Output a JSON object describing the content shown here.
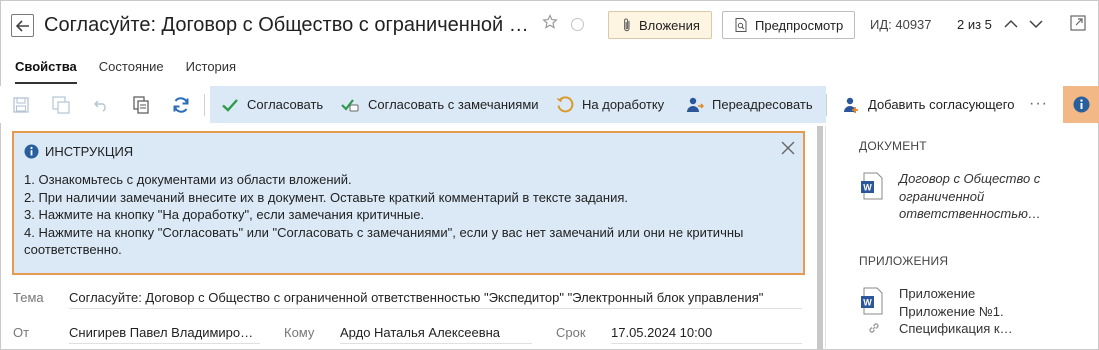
{
  "header": {
    "title": "Согласуйте: Договор с Общество с ограниченной ответственностью \"Экспедитор\"",
    "attachments_label": "Вложения",
    "preview_label": "Предпросмотр",
    "id_text": "ИД: 40937",
    "pager_text": "2 из 5"
  },
  "tabs": [
    {
      "label": "Свойства",
      "active": true
    },
    {
      "label": "Состояние",
      "active": false
    },
    {
      "label": "История",
      "active": false
    }
  ],
  "toolbar": {
    "approve": "Согласовать",
    "approve_remarks": "Согласовать с замечаниями",
    "rework": "На доработку",
    "readdress": "Переадресовать",
    "add_approver": "Добавить согласующего",
    "more": "···"
  },
  "instruction": {
    "title": "ИНСТРУКЦИЯ",
    "lines": [
      "1. Ознакомьтесь с документами из области вложений.",
      "2. При наличии замечаний внесите их в документ. Оставьте краткий комментарий в тексте задания.",
      "3. Нажмите на кнопку \"На доработку\", если замечания критичные.",
      "4. Нажмите на кнопку \"Согласовать\" или \"Согласовать с замечаниями\", если у вас нет замечаний или они не критичны соответственно."
    ]
  },
  "fields": {
    "subject_label": "Тема",
    "subject_value": "Согласуйте: Договор с Общество с ограниченной ответственностью \"Экспедитор\" \"Электронный блок управления\"",
    "from_label": "От",
    "from_value": "Снигирев Павел Владимирович",
    "to_label": "Кому",
    "to_value": "Ардо Наталья Алексеевна",
    "due_label": "Срок",
    "due_value": "17.05.2024 10:00"
  },
  "right_panel": {
    "document_heading": "ДОКУМЕНТ",
    "document_link_lines": [
      "Договор с Общество с",
      "ограниченной",
      "ответственностью…"
    ],
    "attachments_heading": "ПРИЛОЖЕНИЯ",
    "attachment_lines": [
      "Приложение",
      "Приложение №1.",
      "Спецификация к…"
    ]
  },
  "colors": {
    "toolbar_highlight": "#dbe9f7",
    "instruction_border": "#e59a4f",
    "info_button": "#f2b886",
    "approve_check": "#2e9b4a",
    "refresh_blue": "#2a6ebb",
    "word_blue": "#2b579a"
  }
}
